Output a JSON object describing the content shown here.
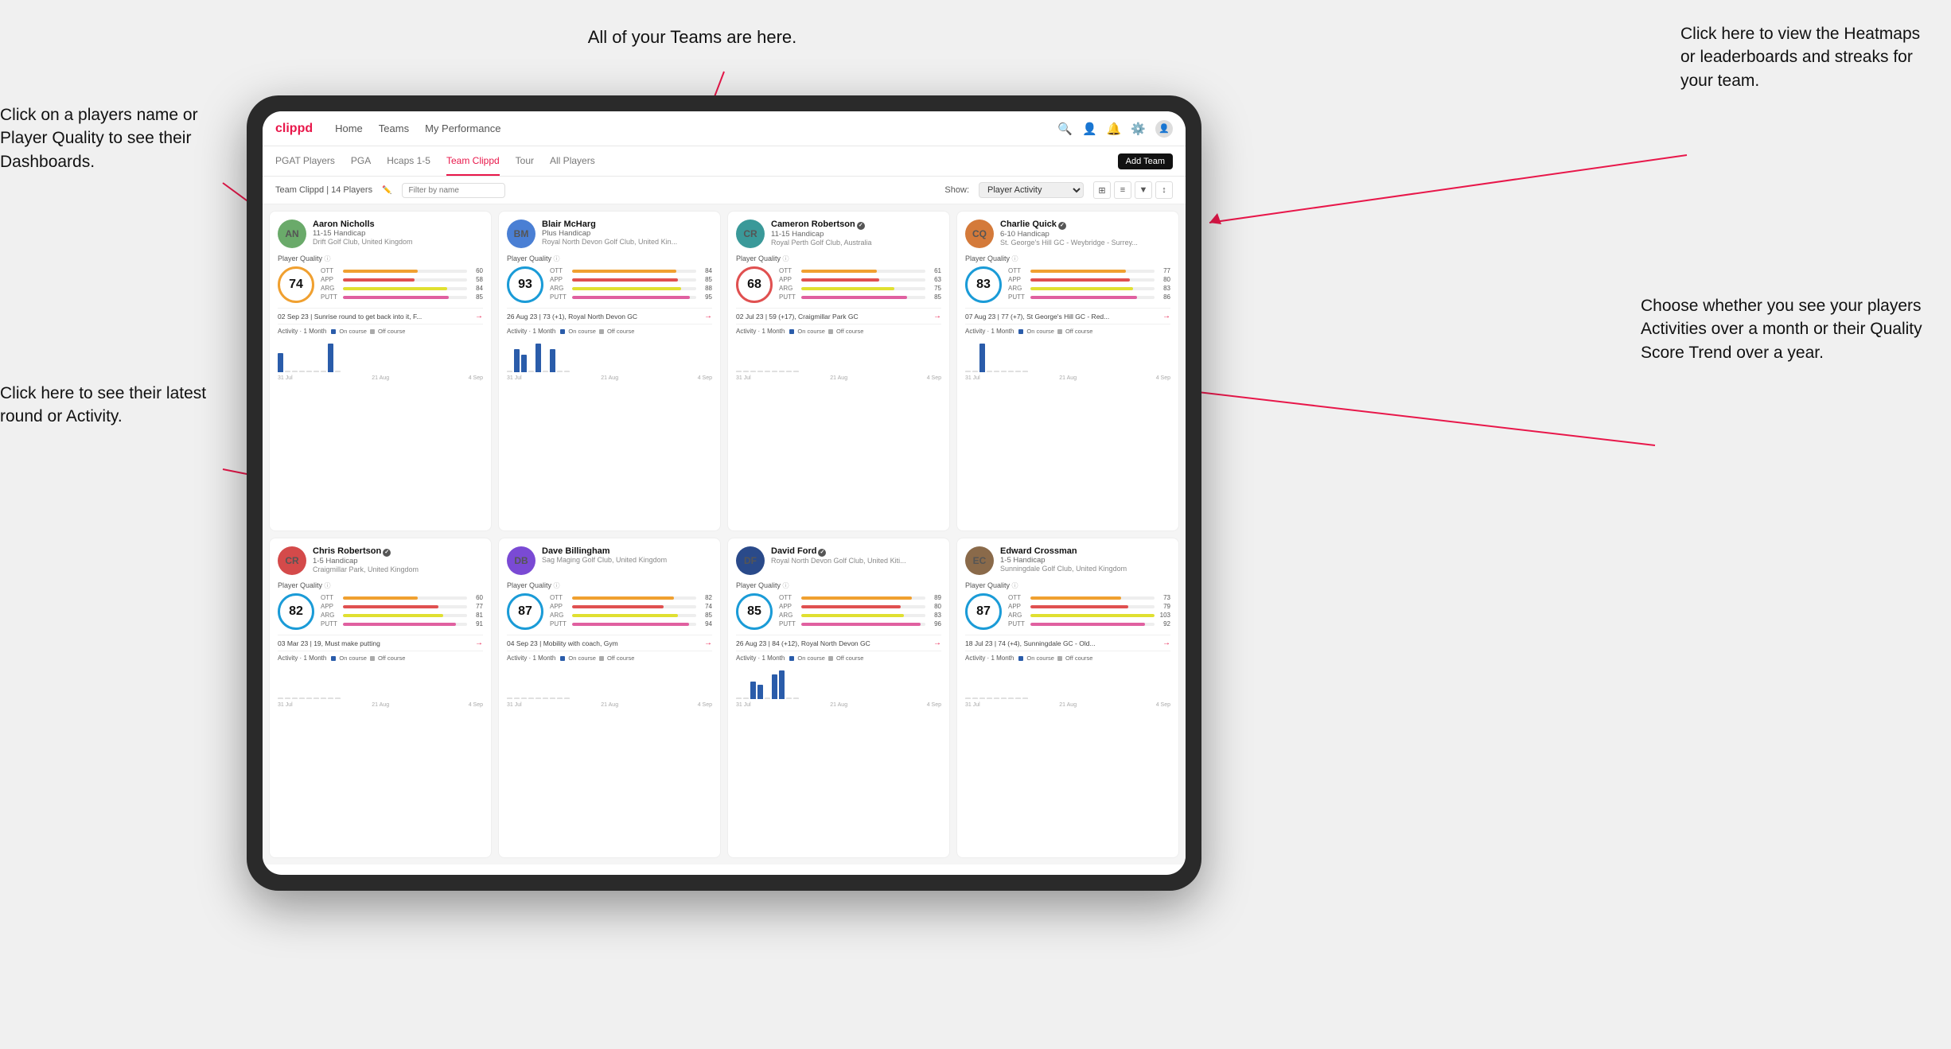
{
  "annotations": {
    "left_top": "Click on a players name\nor Player Quality to see\ntheir Dashboards.",
    "left_bottom": "Click here to see their latest\nround or Activity.",
    "top_center": "All of your Teams are here.",
    "right_top_label": "Click here to view the\nHeatmaps or leaderboards\nand streaks for your team.",
    "right_bottom_label": "Choose whether you see\nyour players Activities over\na month or their Quality\nScore Trend over a year."
  },
  "nav": {
    "logo": "clippd",
    "links": [
      "Home",
      "Teams",
      "My Performance"
    ],
    "add_team": "Add Team"
  },
  "subnav": {
    "items": [
      "PGAT Players",
      "PGA",
      "Hcaps 1-5",
      "Team Clippd",
      "Tour",
      "All Players"
    ],
    "active": "Team Clippd"
  },
  "filter": {
    "team_label": "Team Clippd | 14 Players",
    "filter_placeholder": "Filter by name",
    "show_label": "Show:",
    "show_value": "Player Activity"
  },
  "players": [
    {
      "name": "Aaron Nicholls",
      "handicap": "11-15 Handicap",
      "club": "Drift Golf Club, United Kingdom",
      "quality": 74,
      "stats": [
        {
          "label": "OTT",
          "value": 60,
          "color": "#f0a030"
        },
        {
          "label": "APP",
          "value": 58,
          "color": "#e05050"
        },
        {
          "label": "ARG",
          "value": 84,
          "color": "#e0e030"
        },
        {
          "label": "PUTT",
          "value": 85,
          "color": "#e060a0"
        }
      ],
      "last_round": "02 Sep 23 | Sunrise round to get back into it, F...",
      "activity_bars": [
        2,
        0,
        0,
        0,
        0,
        0,
        0,
        3,
        0
      ],
      "dates": [
        "31 Jul",
        "21 Aug",
        "4 Sep"
      ]
    },
    {
      "name": "Blair McHarg",
      "handicap": "Plus Handicap",
      "club": "Royal North Devon Golf Club, United Kin...",
      "quality": 93,
      "stats": [
        {
          "label": "OTT",
          "value": 84,
          "color": "#f0a030"
        },
        {
          "label": "APP",
          "value": 85,
          "color": "#e05050"
        },
        {
          "label": "ARG",
          "value": 88,
          "color": "#e0e030"
        },
        {
          "label": "PUTT",
          "value": 95,
          "color": "#e060a0"
        }
      ],
      "last_round": "26 Aug 23 | 73 (+1), Royal North Devon GC",
      "activity_bars": [
        0,
        4,
        3,
        0,
        5,
        0,
        4,
        0,
        0
      ],
      "dates": [
        "31 Jul",
        "21 Aug",
        "4 Sep"
      ]
    },
    {
      "name": "Cameron Robertson",
      "verified": true,
      "handicap": "11-15 Handicap",
      "club": "Royal Perth Golf Club, Australia",
      "quality": 68,
      "stats": [
        {
          "label": "OTT",
          "value": 61,
          "color": "#f0a030"
        },
        {
          "label": "APP",
          "value": 63,
          "color": "#e05050"
        },
        {
          "label": "ARG",
          "value": 75,
          "color": "#e0e030"
        },
        {
          "label": "PUTT",
          "value": 85,
          "color": "#e060a0"
        }
      ],
      "last_round": "02 Jul 23 | 59 (+17), Craigmillar Park GC",
      "activity_bars": [
        0,
        0,
        0,
        0,
        0,
        0,
        0,
        0,
        0
      ],
      "dates": [
        "31 Jul",
        "21 Aug",
        "4 Sep"
      ]
    },
    {
      "name": "Charlie Quick",
      "verified": true,
      "handicap": "6-10 Handicap",
      "club": "St. George's Hill GC - Weybridge - Surrey...",
      "quality": 83,
      "stats": [
        {
          "label": "OTT",
          "value": 77,
          "color": "#f0a030"
        },
        {
          "label": "APP",
          "value": 80,
          "color": "#e05050"
        },
        {
          "label": "ARG",
          "value": 83,
          "color": "#e0e030"
        },
        {
          "label": "PUTT",
          "value": 86,
          "color": "#e060a0"
        }
      ],
      "last_round": "07 Aug 23 | 77 (+7), St George's Hill GC - Red...",
      "activity_bars": [
        0,
        0,
        3,
        0,
        0,
        0,
        0,
        0,
        0
      ],
      "dates": [
        "31 Jul",
        "21 Aug",
        "4 Sep"
      ]
    },
    {
      "name": "Chris Robertson",
      "verified": true,
      "handicap": "1-5 Handicap",
      "club": "Craigmillar Park, United Kingdom",
      "quality": 82,
      "stats": [
        {
          "label": "OTT",
          "value": 60,
          "color": "#f0a030"
        },
        {
          "label": "APP",
          "value": 77,
          "color": "#e05050"
        },
        {
          "label": "ARG",
          "value": 81,
          "color": "#e0e030"
        },
        {
          "label": "PUTT",
          "value": 91,
          "color": "#e060a0"
        }
      ],
      "last_round": "03 Mar 23 | 19, Must make putting",
      "activity_bars": [
        0,
        0,
        0,
        0,
        0,
        0,
        0,
        0,
        0
      ],
      "dates": [
        "31 Jul",
        "21 Aug",
        "4 Sep"
      ]
    },
    {
      "name": "Dave Billingham",
      "handicap": "",
      "club": "Sag Maging Golf Club, United Kingdom",
      "quality": 87,
      "stats": [
        {
          "label": "OTT",
          "value": 82,
          "color": "#f0a030"
        },
        {
          "label": "APP",
          "value": 74,
          "color": "#e05050"
        },
        {
          "label": "ARG",
          "value": 85,
          "color": "#e0e030"
        },
        {
          "label": "PUTT",
          "value": 94,
          "color": "#e060a0"
        }
      ],
      "last_round": "04 Sep 23 | Mobility with coach, Gym",
      "activity_bars": [
        0,
        0,
        0,
        0,
        0,
        0,
        0,
        0,
        0
      ],
      "dates": [
        "31 Jul",
        "21 Aug",
        "4 Sep"
      ]
    },
    {
      "name": "David Ford",
      "verified": true,
      "handicap": "",
      "club": "Royal North Devon Golf Club, United Kiti...",
      "quality": 85,
      "stats": [
        {
          "label": "OTT",
          "value": 89,
          "color": "#f0a030"
        },
        {
          "label": "APP",
          "value": 80,
          "color": "#e05050"
        },
        {
          "label": "ARG",
          "value": 83,
          "color": "#e0e030"
        },
        {
          "label": "PUTT",
          "value": 96,
          "color": "#e060a0"
        }
      ],
      "last_round": "26 Aug 23 | 84 (+12), Royal North Devon GC",
      "activity_bars": [
        0,
        0,
        5,
        4,
        0,
        7,
        8,
        0,
        0
      ],
      "dates": [
        "31 Jul",
        "21 Aug",
        "4 Sep"
      ]
    },
    {
      "name": "Edward Crossman",
      "handicap": "1-5 Handicap",
      "club": "Sunningdale Golf Club, United Kingdom",
      "quality": 87,
      "stats": [
        {
          "label": "OTT",
          "value": 73,
          "color": "#f0a030"
        },
        {
          "label": "APP",
          "value": 79,
          "color": "#e05050"
        },
        {
          "label": "ARG",
          "value": 103,
          "color": "#e0e030"
        },
        {
          "label": "PUTT",
          "value": 92,
          "color": "#e060a0"
        }
      ],
      "last_round": "18 Jul 23 | 74 (+4), Sunningdale GC - Old...",
      "activity_bars": [
        0,
        0,
        0,
        0,
        0,
        0,
        0,
        0,
        0
      ],
      "dates": [
        "31 Jul",
        "21 Aug",
        "4 Sep"
      ]
    }
  ],
  "activity": {
    "title": "Activity",
    "period": "1 Month",
    "on_course_label": "On course",
    "off_course_label": "Off course",
    "on_course_color": "#2a5caa",
    "off_course_color": "#aaaaaa"
  },
  "avatar_colors": [
    "#6aaa6a",
    "#4a7fd4",
    "#3a9999",
    "#d47a3a",
    "#d44a4a",
    "#7a4ad4",
    "#2a4a8a",
    "#8a6a4a"
  ]
}
